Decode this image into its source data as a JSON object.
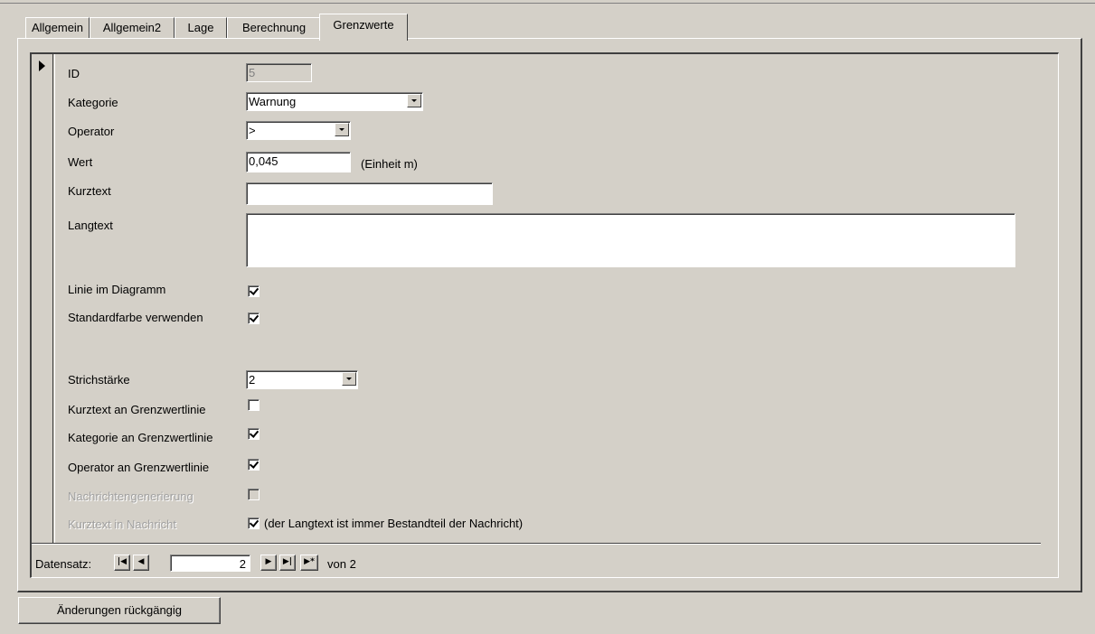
{
  "tabs": [
    "Allgemein",
    "Allgemein2",
    "Lage",
    "Berechnung",
    "Grenzwerte"
  ],
  "active_tab": "Grenzwerte",
  "fields": {
    "id": {
      "label": "ID",
      "value": "5"
    },
    "kategorie": {
      "label": "Kategorie",
      "value": "Warnung"
    },
    "operator": {
      "label": "Operator",
      "value": ">"
    },
    "wert": {
      "label": "Wert",
      "value": "0,045",
      "unit_note": "(Einheit m)"
    },
    "kurztext": {
      "label": "Kurztext",
      "value": ""
    },
    "langtext": {
      "label": "Langtext",
      "value": ""
    },
    "linie_im_diagramm": {
      "label": "Linie im Diagramm",
      "checked": true
    },
    "standardfarbe": {
      "label": "Standardfarbe verwenden",
      "checked": true
    },
    "strichstaerke": {
      "label": "Strichstärke",
      "value": "2"
    },
    "kurztext_an_linie": {
      "label": "Kurztext an Grenzwertlinie",
      "checked": false
    },
    "kategorie_an_linie": {
      "label": "Kategorie an Grenzwertlinie",
      "checked": true
    },
    "operator_an_linie": {
      "label": "Operator an Grenzwertlinie",
      "checked": true
    },
    "nachrichtengenerierung": {
      "label": "Nachrichtengenerierung",
      "checked": false,
      "disabled": true
    },
    "kurztext_in_nachricht": {
      "label": "Kurztext in Nachricht",
      "checked": true,
      "disabled": true,
      "note": "(der Langtext ist immer Bestandteil der Nachricht)"
    }
  },
  "navigator": {
    "label": "Datensatz:",
    "current": "2",
    "of_text": "von 2",
    "icons": [
      "first-record-icon",
      "prev-record-icon",
      "next-record-icon",
      "last-record-icon",
      "new-record-icon"
    ]
  },
  "buttons": {
    "undo": "Änderungen rückgängig"
  }
}
